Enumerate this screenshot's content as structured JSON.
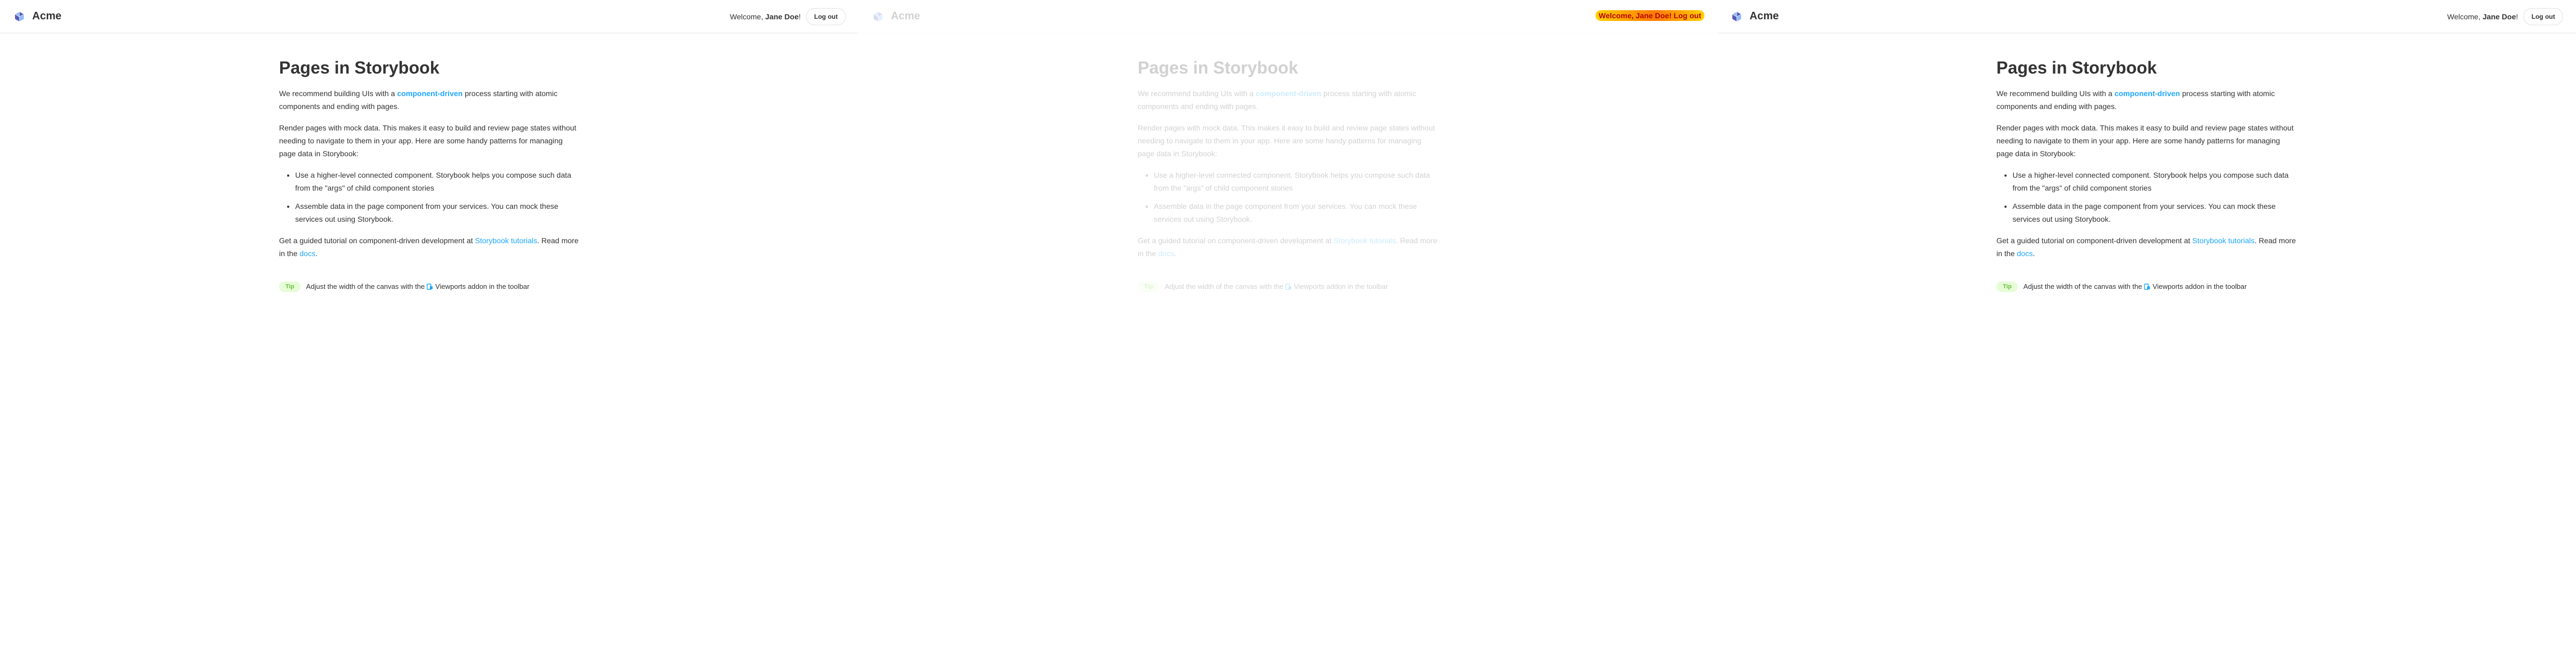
{
  "header": {
    "brand": "Acme",
    "welcome_prefix": "Welcome, ",
    "user_name": "Jane Doe",
    "welcome_suffix": "!",
    "logout_label": "Log out"
  },
  "page": {
    "title": "Pages in Storybook",
    "p1_before": "We recommend building UIs with a ",
    "p1_link": "component-driven",
    "p1_after": " process starting with atomic components and ending with pages.",
    "p2": "Render pages with mock data. This makes it easy to build and review page states without needing to navigate to them in your app. Here are some handy patterns for managing page data in Storybook:",
    "bullet1": "Use a higher-level connected component. Storybook helps you compose such data from the \"args\" of child component stories",
    "bullet2": "Assemble data in the page component from your services. You can mock these services out using Storybook.",
    "p3_before": "Get a guided tutorial on component-driven development at ",
    "p3_link": "Storybook tutorials",
    "p3_middle": ". Read more in the ",
    "p3_link2": "docs",
    "p3_after": ".",
    "tip_label": "Tip",
    "tip_before": "Adjust the width of the canvas with the ",
    "tip_after": "Viewports addon in the toolbar"
  },
  "diff_overlay": "Welcome, Jane Doe!  Log out",
  "colors": {
    "text": "#333333",
    "link": "#1ea7fd",
    "tip_bg": "#e7fdd8",
    "tip_text": "#66bf3c",
    "logo_light": "#91baf8",
    "logo_dark": "#555ab9"
  }
}
